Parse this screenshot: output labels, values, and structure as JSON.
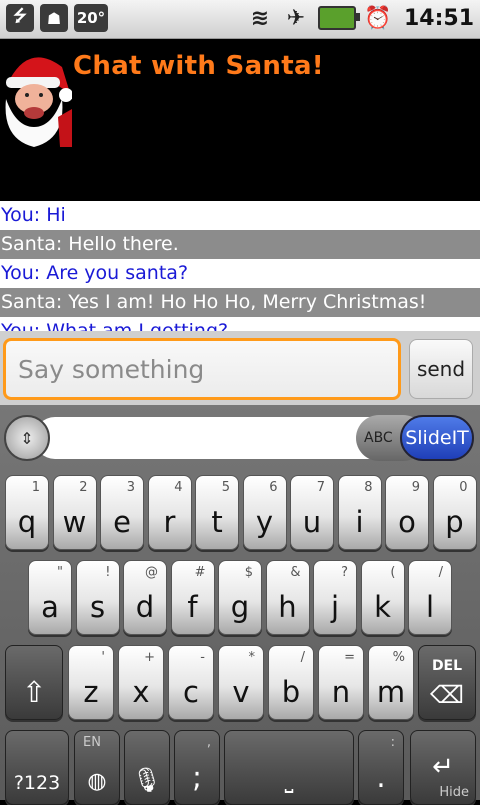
{
  "status_bar": {
    "left_icons": [
      "usb-icon",
      "android-debug-icon",
      "temperature-badge"
    ],
    "temperature": "20°",
    "right_icons": [
      "wifi-icon",
      "airplane-signal-icon",
      "battery-charging-icon",
      "alarm-icon"
    ],
    "time": "14:51"
  },
  "header": {
    "title": "Chat with Santa!",
    "avatar": "santa-avatar"
  },
  "chat": {
    "messages": [
      {
        "speaker": "you",
        "text": "You: Hi"
      },
      {
        "speaker": "santa",
        "text": "Santa: Hello there."
      },
      {
        "speaker": "you",
        "text": "You: Are you santa?"
      },
      {
        "speaker": "santa",
        "text": "Santa: Yes I am! Ho Ho Ho, Merry Christmas!"
      },
      {
        "speaker": "you",
        "text": "You: What am I getting?"
      }
    ]
  },
  "input": {
    "placeholder": "Say something",
    "value": "",
    "send_label": "send"
  },
  "keyboard": {
    "topbar": {
      "abc_label": "ABC",
      "slideit_label": "SlideIT"
    },
    "row1": [
      {
        "main": "q",
        "alt": "1"
      },
      {
        "main": "w",
        "alt": "2"
      },
      {
        "main": "e",
        "alt": "3"
      },
      {
        "main": "r",
        "alt": "4"
      },
      {
        "main": "t",
        "alt": "5"
      },
      {
        "main": "y",
        "alt": "6"
      },
      {
        "main": "u",
        "alt": "7"
      },
      {
        "main": "i",
        "alt": "8"
      },
      {
        "main": "o",
        "alt": "9"
      },
      {
        "main": "p",
        "alt": "0"
      }
    ],
    "row2": [
      {
        "main": "a",
        "alt": "\""
      },
      {
        "main": "s",
        "alt": "!"
      },
      {
        "main": "d",
        "alt": "@"
      },
      {
        "main": "f",
        "alt": "#"
      },
      {
        "main": "g",
        "alt": "$"
      },
      {
        "main": "h",
        "alt": "&"
      },
      {
        "main": "j",
        "alt": "?"
      },
      {
        "main": "k",
        "alt": "("
      },
      {
        "main": "l",
        "alt": "/"
      }
    ],
    "row3": [
      {
        "main": "z",
        "alt": "'"
      },
      {
        "main": "x",
        "alt": "+"
      },
      {
        "main": "c",
        "alt": "-"
      },
      {
        "main": "v",
        "alt": "*"
      },
      {
        "main": "b",
        "alt": "/"
      },
      {
        "main": "n",
        "alt": "="
      },
      {
        "main": "m",
        "alt": "%"
      }
    ],
    "del_label": "DEL",
    "sym_label": "?123",
    "lang_label": "EN",
    "punct_main": ";",
    "punct_alt": ",",
    "dot_main": ".",
    "dot_alt": ":",
    "hide_label": "Hide"
  }
}
